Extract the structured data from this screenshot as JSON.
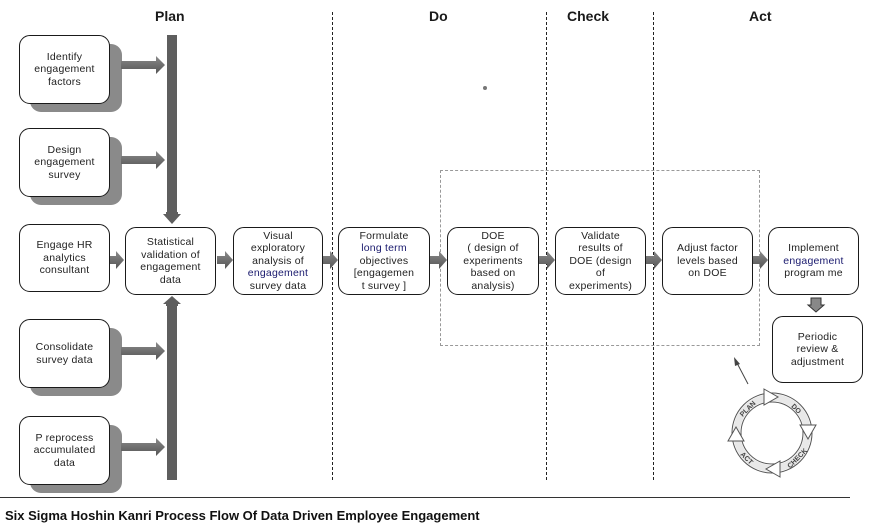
{
  "phases": {
    "plan": "Plan",
    "do": "Do",
    "check": "Check",
    "act": "Act"
  },
  "left_inputs": [
    {
      "lines": [
        "Identify",
        "engagement",
        "factors"
      ]
    },
    {
      "lines": [
        "Design",
        "engagement",
        "survey"
      ]
    },
    {
      "lines": [
        "Engage HR",
        "analytics",
        "consultant"
      ]
    },
    {
      "lines": [
        "Consolidate",
        "survey data"
      ]
    },
    {
      "lines": [
        "P reprocess",
        "accumulated",
        "data"
      ]
    }
  ],
  "flow_steps": [
    {
      "lines": [
        "Statistical",
        "validation of",
        "engagement",
        "data"
      ]
    },
    {
      "lines": [
        "Visual",
        "exploratory",
        "analysis of",
        "engagement",
        "survey data"
      ],
      "blue_lines": [
        3
      ]
    },
    {
      "lines": [
        "Formulate",
        "long term",
        "objectives",
        "[engagemen",
        "t survey ]"
      ],
      "blue_lines": [
        1
      ]
    },
    {
      "lines": [
        "DOE",
        "( design of",
        "experiments",
        "based on",
        "analysis)"
      ]
    },
    {
      "lines": [
        "Validate",
        "results of",
        "DOE (design",
        "of",
        "experiments)"
      ]
    },
    {
      "lines": [
        "Adjust factor",
        "levels based",
        "on DOE"
      ]
    },
    {
      "lines": [
        "Implement",
        "engagement",
        "program me"
      ],
      "blue_lines": [
        1
      ]
    }
  ],
  "review_step": {
    "lines": [
      "Periodic",
      "review &",
      "adjustment"
    ]
  },
  "pdca_cycle": {
    "labels": [
      "PLAN",
      "DO",
      "CHECK",
      "ACT"
    ]
  },
  "caption": "Six Sigma Hoshin Kanri Process Flow Of Data Driven Employee Engagement",
  "colors": {
    "arrow": "#6a6a6a",
    "highlight_text": "#1a1a6e",
    "shadow": "#8a8a8a"
  }
}
